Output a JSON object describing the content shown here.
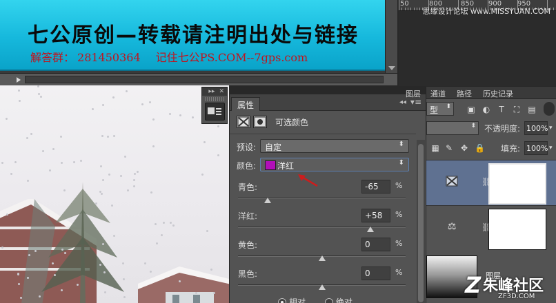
{
  "banner": {
    "logo_text": "",
    "title": "七公原创—转载请注明出处与链接",
    "qq_label": "解答群：",
    "qq_number": "281450364",
    "site": "记住七公PS.COM--7gps.com"
  },
  "ruler": {
    "numbers": [
      "50",
      "800",
      "850",
      "900",
      "950"
    ],
    "watermark": "思缘设计论坛 www.MISSYUAN.COM"
  },
  "properties": {
    "tab_label": "属性",
    "collapse_glyph": "◂◂",
    "menu_glyph": "▾≡",
    "adjustment_kind": "可选颜色",
    "preset_label": "预设:",
    "preset_value": "自定",
    "colors_label": "颜色:",
    "colors_value": "洋红",
    "swatch_color": "#b10fb8",
    "sliders": [
      {
        "label": "青色:",
        "value": "-65",
        "unit": "%",
        "level": -65
      },
      {
        "label": "洋红:",
        "value": "+58",
        "unit": "%",
        "level": 58
      },
      {
        "label": "黄色:",
        "value": "0",
        "unit": "%",
        "level": 0
      },
      {
        "label": "黑色:",
        "value": "0",
        "unit": "%",
        "level": 0
      }
    ],
    "mode_relative": "相对",
    "mode_absolute": "绝对",
    "mode_selected": "relative"
  },
  "layers": {
    "tabs": [
      "图层",
      "通道",
      "路径",
      "历史记录"
    ],
    "filter_value": "型",
    "opacity_label": "不透明度:",
    "opacity_value": "100%",
    "fill_label": "填充:",
    "fill_value": "100%",
    "bottom_layer_name": "图层"
  },
  "watermark_bottom": {
    "z": "Z",
    "big": "朱峰社区",
    "small": "ZF3D.COM"
  },
  "colors": {
    "accent_selection": "#5f7191",
    "banner_cyan": "#16b8dc",
    "arrow_red": "#cc1d1d"
  }
}
